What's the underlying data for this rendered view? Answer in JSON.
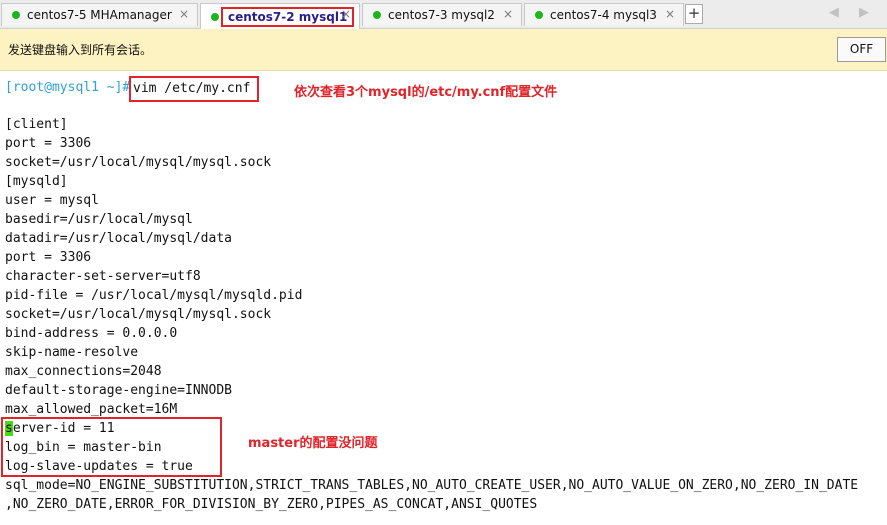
{
  "tabs": [
    {
      "label": "centos7-5 MHAmanager",
      "active": false
    },
    {
      "label": "centos7-2 mysql1",
      "active": true
    },
    {
      "label": "centos7-3 mysql2",
      "active": false
    },
    {
      "label": "centos7-4 mysql3",
      "active": false
    }
  ],
  "add_tab_label": "+",
  "nav_arrows": "◀ ▶",
  "notification": {
    "text": "发送键盘输入到所有会话。",
    "off_label": "OFF"
  },
  "terminal": {
    "prompt": "[root@mysql1 ~]#",
    "command": "vim /etc/my.cnf",
    "lines": [
      "[client]",
      "port = 3306",
      "socket=/usr/local/mysql/mysql.sock",
      "[mysqld]",
      "user = mysql",
      "basedir=/usr/local/mysql",
      "datadir=/usr/local/mysql/data",
      "port = 3306",
      "character-set-server=utf8",
      "pid-file = /usr/local/mysql/mysqld.pid",
      "socket=/usr/local/mysql/mysql.sock",
      "bind-address = 0.0.0.0",
      "skip-name-resolve",
      "max_connections=2048",
      "default-storage-engine=INNODB",
      "max_allowed_packet=16M",
      "erver-id = 11",
      "log_bin = master-bin",
      "log-slave-updates = true",
      "sql_mode=NO_ENGINE_SUBSTITUTION,STRICT_TRANS_TABLES,NO_AUTO_CREATE_USER,NO_AUTO_VALUE_ON_ZERO,NO_ZERO_IN_DATE",
      ",NO_ZERO_DATE,ERROR_FOR_DIVISION_BY_ZERO,PIPES_AS_CONCAT,ANSI_QUOTES"
    ],
    "cursor_char": "s"
  },
  "annotations": {
    "top": "依次查看3个mysql的/etc/my.cnf配置文件",
    "master": "master的配置没问题"
  },
  "colors": {
    "prompt": "#2fa0d8",
    "annotation": "#e0242a",
    "cursor": "#4ad81a",
    "status_dot": "#1cb51c",
    "notification_bg": "#fdf3c2"
  }
}
